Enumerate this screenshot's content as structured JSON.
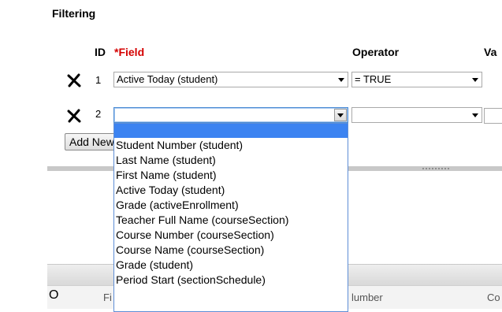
{
  "section": {
    "title": "Filtering"
  },
  "headers": {
    "id": "ID",
    "required_mark": "*",
    "field": "Field",
    "operator": "Operator",
    "value": "Va"
  },
  "rows": [
    {
      "num": "1",
      "field": "Active Today (student)",
      "operator": "= TRUE"
    },
    {
      "num": "2",
      "field": "",
      "operator": ""
    }
  ],
  "add_button": {
    "label": "Add New"
  },
  "dropdown_options": [
    "",
    "Student Number (student)",
    "Last Name (student)",
    "First Name (student)",
    "Active Today (student)",
    "Grade (activeEnrollment)",
    "Teacher Full Name (courseSection)",
    "Course Number (courseSection)",
    "Course Name (courseSection)",
    "Grade (student)",
    "Period Start (sectionSchedule)"
  ],
  "grid": {
    "left_marker": "O",
    "col1": "Fi",
    "col2": "lumber",
    "col3": "Co"
  },
  "colors": {
    "required": "#d40000",
    "highlight": "#3c83f1",
    "focus_border": "#5e8ed6"
  }
}
